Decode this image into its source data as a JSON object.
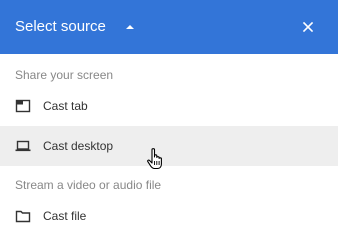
{
  "colors": {
    "header_bg": "#3375d8",
    "header_text": "#ffffff",
    "hover_bg": "#eeeeee",
    "section_text": "#888888",
    "item_text": "#333333"
  },
  "header": {
    "title": "Select source",
    "caret_icon": "caret-up-icon",
    "close_icon": "close-icon"
  },
  "sections": [
    {
      "label": "Share your screen",
      "items": [
        {
          "label": "Cast tab",
          "icon": "tab-window-icon"
        },
        {
          "label": "Cast desktop",
          "icon": "laptop-icon",
          "hovered": true
        }
      ]
    },
    {
      "label": "Stream a video or audio file",
      "items": [
        {
          "label": "Cast file",
          "icon": "folder-icon"
        }
      ]
    }
  ],
  "cursor": "hand-pointer-icon"
}
